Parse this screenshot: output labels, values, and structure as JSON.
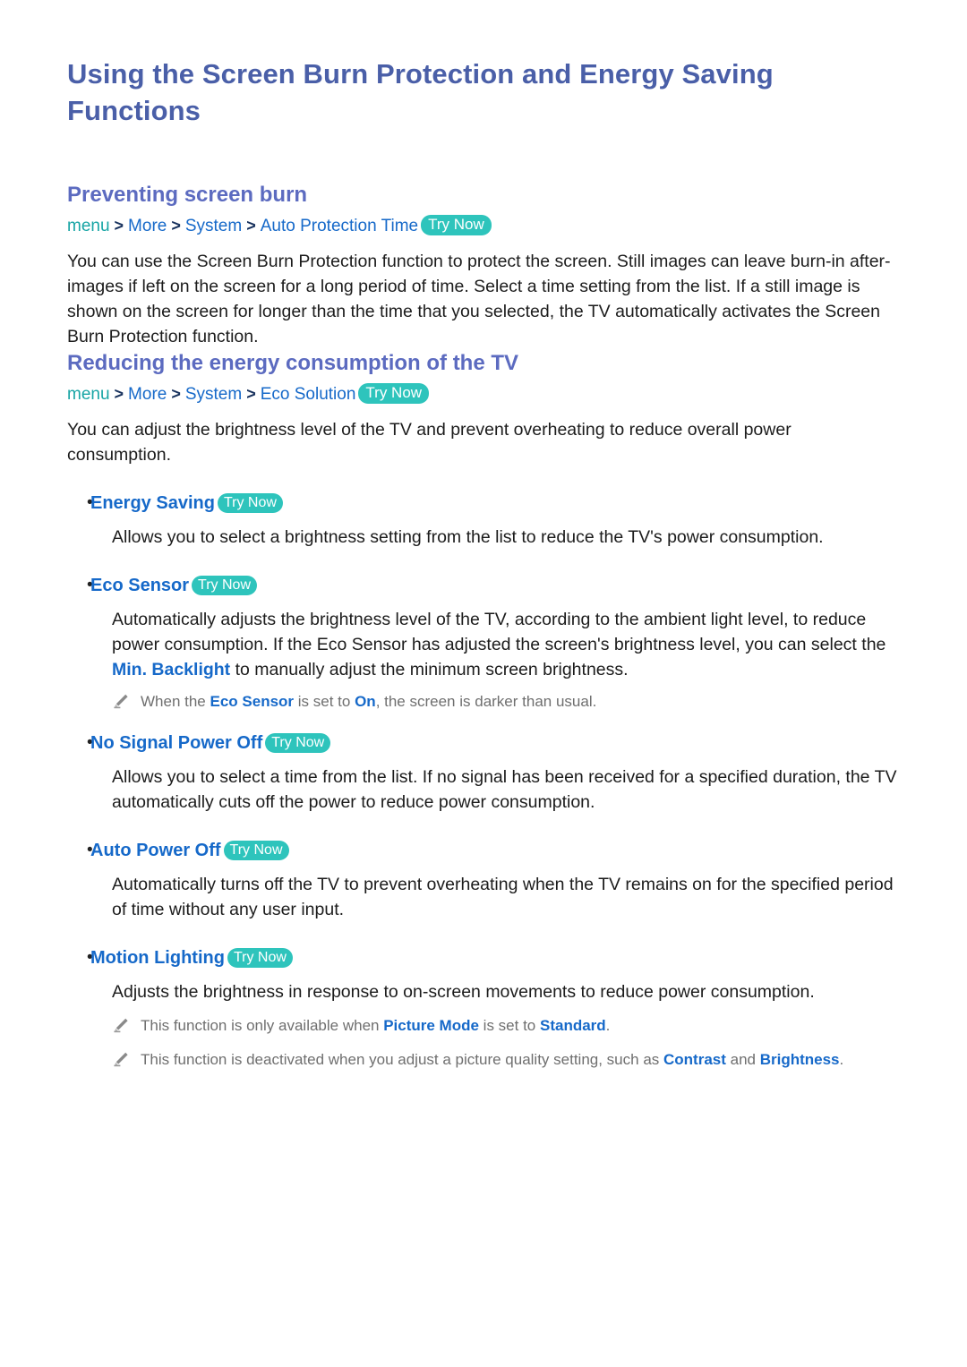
{
  "document": {
    "title": "Using the Screen Burn Protection and Energy Saving Functions"
  },
  "sections": [
    {
      "heading": "Preventing screen burn",
      "breadcrumb": {
        "root": "menu",
        "separator": ">",
        "items": [
          "More",
          "System",
          "Auto Protection Time"
        ],
        "badge": "Try Now"
      },
      "paragraph": "You can use the Screen Burn Protection function to protect the screen. Still images can leave burn-in after-images if left on the screen for a long period of time. Select a time setting from the list. If a still image is shown on the screen for longer than the time that you selected, the TV automatically activates the Screen Burn Protection function."
    },
    {
      "heading": "Reducing the energy consumption of the TV",
      "breadcrumb": {
        "root": "menu",
        "separator": ">",
        "items": [
          "More",
          "System",
          "Eco Solution"
        ],
        "badge": "Try Now"
      },
      "paragraph": "You can adjust the brightness level of the TV and prevent overheating to reduce overall power consumption."
    }
  ],
  "features": [
    {
      "label": "Energy Saving",
      "badge": "Try Now",
      "description": "Allows you to select a brightness setting from the list to reduce the TV's power consumption."
    },
    {
      "label": "Eco Sensor",
      "badge": "Try Now",
      "description_part1": "Automatically adjusts the brightness level of the TV, according to the ambient light level, to reduce power consumption. If the Eco Sensor has adjusted the screen's brightness level, you can select the ",
      "description_link": "Min. Backlight",
      "description_part2": " to manually adjust the minimum screen brightness.",
      "note": {
        "icon": "pencil-icon",
        "part1": "When the ",
        "bold1": "Eco Sensor",
        "part2": " is set to ",
        "bold2": "On",
        "part3": ", the screen is darker than usual."
      }
    },
    {
      "label": "No Signal Power Off",
      "badge": "Try Now",
      "description": "Allows you to select a time from the list. If no signal has been received for a specified duration, the TV automatically cuts off the power to reduce power consumption."
    },
    {
      "label": "Auto Power Off",
      "badge": "Try Now",
      "description": "Automatically turns off the TV to prevent overheating when the TV remains on for the specified period of time without any user input."
    },
    {
      "label": "Motion Lighting",
      "badge": "Try Now",
      "description": "Adjusts the brightness in response to on-screen movements to reduce power consumption."
    }
  ],
  "footnotes": [
    {
      "icon": "pencil-icon",
      "part1": "This function is only available when ",
      "bold1": "Picture Mode",
      "part2": " is set to ",
      "bold2": "Standard",
      "part3": "."
    },
    {
      "icon": "pencil-icon",
      "part1": "This function is deactivated when you adjust a picture quality setting, such as ",
      "bold1": "Contrast",
      "part2": " and ",
      "bold2": "Brightness",
      "part3": "."
    }
  ],
  "colors": {
    "title": "#4a5fa8",
    "heading": "#5c6bc0",
    "link": "#1669c9",
    "menu_root": "#18a5a5",
    "badge_bg": "#2ec4bc",
    "note_text": "#6f6f6f"
  }
}
